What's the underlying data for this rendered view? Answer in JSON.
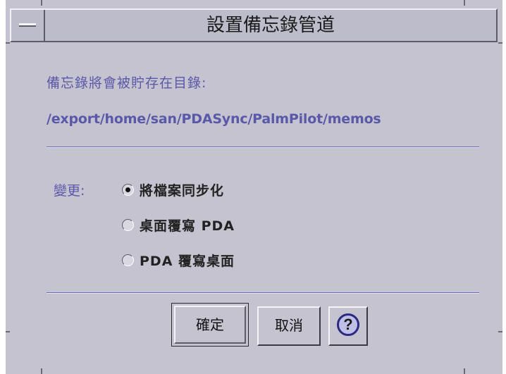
{
  "window": {
    "title": "設置備忘錄管道"
  },
  "directory": {
    "label": "備忘錄將會被貯存在目錄:",
    "path": "/export/home/san/PDASync/PalmPilot/memos"
  },
  "change": {
    "label": "變更:",
    "options": [
      {
        "label": "將檔案同步化",
        "selected": true
      },
      {
        "label": "桌面覆寫 PDA",
        "selected": false
      },
      {
        "label": "PDA 覆寫桌面",
        "selected": false
      }
    ]
  },
  "buttons": {
    "ok_label": "確定",
    "cancel_label": "取消",
    "help_glyph": "?"
  },
  "colors": {
    "window_bg": "#c4c3cf",
    "label_text": "#5a58a8",
    "separator": "#6b69c0"
  }
}
